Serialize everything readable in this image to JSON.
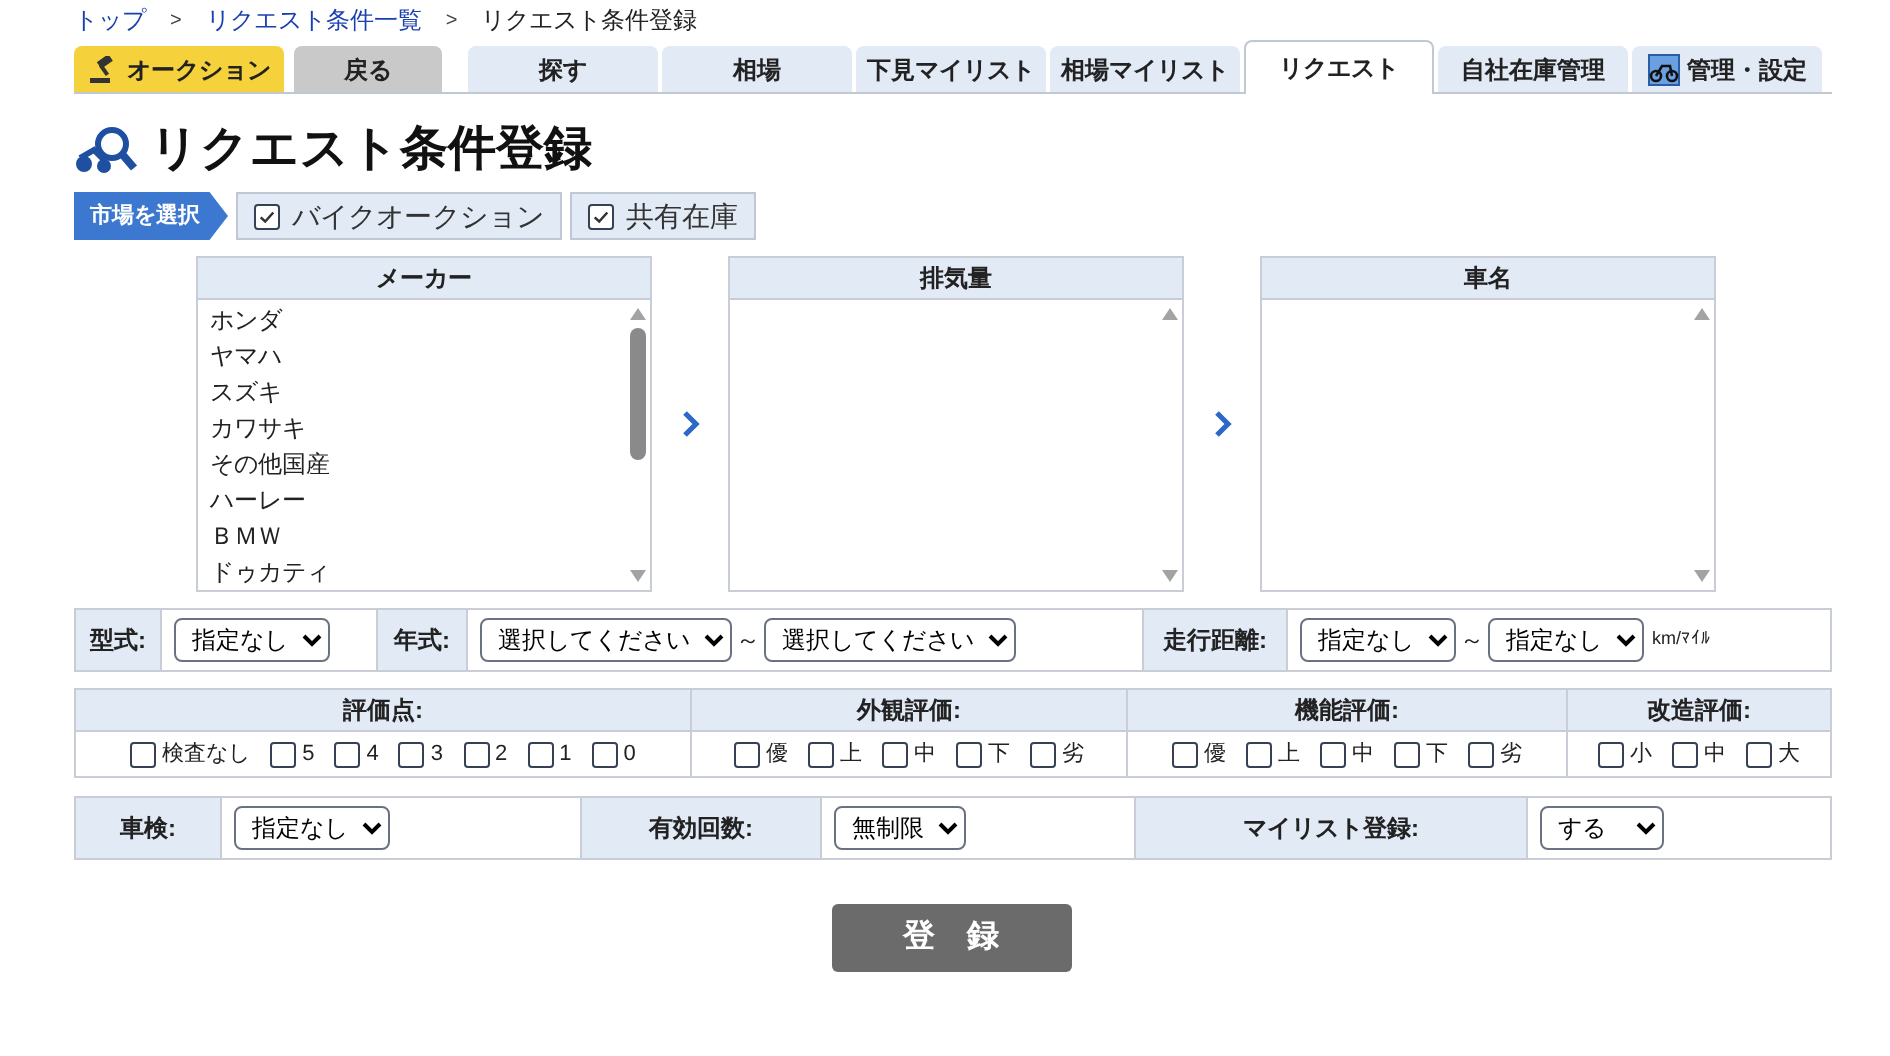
{
  "breadcrumb": [
    {
      "kind": "link",
      "label": "トップ"
    },
    {
      "kind": "separator",
      "label": ">"
    },
    {
      "kind": "link",
      "label": "リクエスト条件一覧"
    },
    {
      "kind": "separator",
      "label": ">"
    },
    {
      "kind": "current",
      "label": "リクエスト条件登録"
    }
  ],
  "tabs": [
    {
      "kind": "auction",
      "label": "オークション",
      "selected": false
    },
    {
      "kind": "back",
      "label": "戻る",
      "selected": false
    },
    {
      "kind": "nav",
      "label": "探す",
      "selected": false
    },
    {
      "kind": "nav",
      "label": "相場",
      "selected": false
    },
    {
      "kind": "nav",
      "label": "下見マイリスト",
      "selected": false
    },
    {
      "kind": "nav",
      "label": "相場マイリスト",
      "selected": false
    },
    {
      "kind": "nav",
      "label": "リクエスト",
      "selected": true
    },
    {
      "kind": "nav",
      "label": "自社在庫管理",
      "selected": false
    },
    {
      "kind": "settings",
      "label": "管理・設定",
      "selected": false
    }
  ],
  "page_title": "リクエスト条件登録",
  "market": {
    "label": "市場を選択",
    "options": [
      {
        "label": "バイクオークション",
        "checked": true
      },
      {
        "label": "共有在庫",
        "checked": true
      }
    ]
  },
  "lists": [
    {
      "header": "メーカー",
      "items": [
        "ホンダ",
        "ヤマハ",
        "スズキ",
        "カワサキ",
        "その他国産",
        "ハーレー",
        "ＢＭＷ",
        "ドゥカティ"
      ]
    },
    {
      "header": "排気量"
    },
    {
      "header": "車名"
    }
  ],
  "filters": [
    {
      "label": "型式:",
      "selects": [
        "指定なし"
      ]
    },
    {
      "label": "年式:",
      "selects": [
        "選択してください",
        "選択してください"
      ],
      "separator": "～"
    },
    {
      "label": "走行距離:",
      "selects": [
        "指定なし",
        "指定なし"
      ],
      "separator": "～",
      "unit": "km/ﾏｲﾙ"
    }
  ],
  "ratings": [
    {
      "title": "評価点:",
      "options": [
        {
          "label": "検査なし",
          "checked": false
        },
        {
          "label": "5",
          "checked": false
        },
        {
          "label": "4",
          "checked": false
        },
        {
          "label": "3",
          "checked": false
        },
        {
          "label": "2",
          "checked": false
        },
        {
          "label": "1",
          "checked": false
        },
        {
          "label": "0",
          "checked": false
        }
      ]
    },
    {
      "title": "外観評価:",
      "options": [
        {
          "label": "優",
          "checked": false
        },
        {
          "label": "上",
          "checked": false
        },
        {
          "label": "中",
          "checked": false
        },
        {
          "label": "下",
          "checked": false
        },
        {
          "label": "劣",
          "checked": false
        }
      ]
    },
    {
      "title": "機能評価:",
      "options": [
        {
          "label": "優",
          "checked": false
        },
        {
          "label": "上",
          "checked": false
        },
        {
          "label": "中",
          "checked": false
        },
        {
          "label": "下",
          "checked": false
        },
        {
          "label": "劣",
          "checked": false
        }
      ]
    },
    {
      "title": "改造評価:",
      "options": [
        {
          "label": "小",
          "checked": false
        },
        {
          "label": "中",
          "checked": false
        },
        {
          "label": "大",
          "checked": false
        }
      ]
    }
  ],
  "settings": [
    {
      "label": "車検:",
      "select": "指定なし"
    },
    {
      "label": "有効回数:",
      "select": "無制限"
    },
    {
      "label": "マイリスト登録:",
      "select": "する"
    }
  ],
  "submit": "登　録"
}
